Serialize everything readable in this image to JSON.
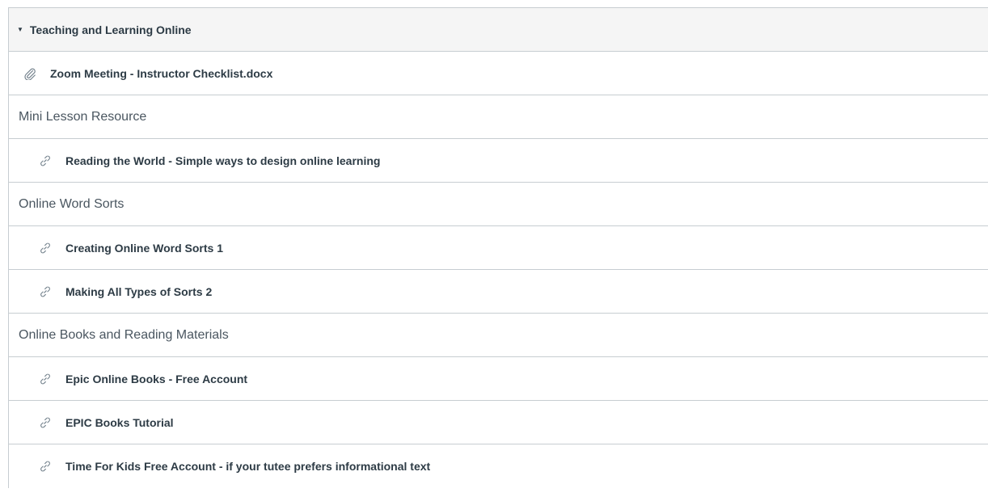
{
  "module": {
    "title": "Teaching and Learning Online",
    "caret_icon": "caret-down-icon"
  },
  "items": [
    {
      "type": "file",
      "icon": "paperclip-icon",
      "title": "Zoom Meeting - Instructor Checklist.docx"
    },
    {
      "type": "subheader",
      "title": "Mini Lesson Resource"
    },
    {
      "type": "link",
      "icon": "link-icon",
      "title": "Reading the World - Simple ways to design online learning"
    },
    {
      "type": "subheader",
      "title": "Online Word Sorts"
    },
    {
      "type": "link",
      "icon": "link-icon",
      "title": "Creating Online Word Sorts 1"
    },
    {
      "type": "link",
      "icon": "link-icon",
      "title": "Making All Types of Sorts 2"
    },
    {
      "type": "subheader",
      "title": "Online Books and Reading Materials"
    },
    {
      "type": "link",
      "icon": "link-icon",
      "title": "Epic Online Books - Free Account"
    },
    {
      "type": "link",
      "icon": "link-icon",
      "title": "EPIC Books Tutorial"
    },
    {
      "type": "link",
      "icon": "link-icon",
      "title": "Time For Kids Free Account - if your tutee prefers informational text"
    }
  ],
  "colors": {
    "header_bg": "#f5f5f5",
    "border": "#c7cdd1",
    "text": "#2d3b45",
    "subheader_text": "#4a5660",
    "icon": "#73818c"
  }
}
